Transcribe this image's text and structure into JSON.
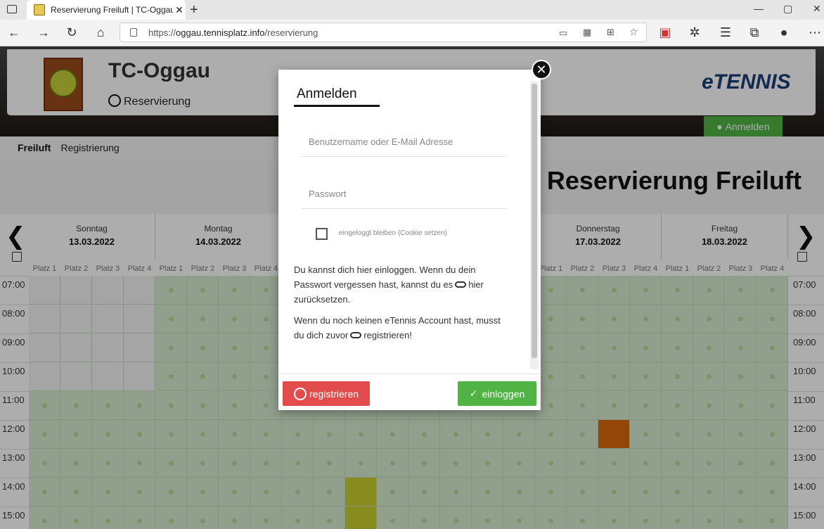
{
  "browser": {
    "tab_title": "Reservierung Freiluft | TC-Oggau",
    "url_prefix": "https://",
    "url_host": "oggau.tennisplatz.info",
    "url_path": "/reservierung"
  },
  "header": {
    "club_name": "TC-Oggau",
    "subtitle": "Reservierung",
    "brand": "eTENNIS",
    "login_button": "Anmelden"
  },
  "menu": {
    "items": [
      "Freiluft",
      "Registrierung"
    ]
  },
  "headline": "Reservierung Freiluft",
  "calendar": {
    "days": [
      {
        "weekday": "Sonntag",
        "date": "13.03.2022"
      },
      {
        "weekday": "Montag",
        "date": "14.03.2022"
      },
      {
        "weekday": "",
        "date": ""
      },
      {
        "weekday": "",
        "date": ""
      },
      {
        "weekday": "Donnerstag",
        "date": "17.03.2022"
      },
      {
        "weekday": "Freitag",
        "date": "18.03.2022"
      }
    ],
    "courts": [
      "Platz 1",
      "Platz 2",
      "Platz 3",
      "Platz 4"
    ],
    "times": [
      "07:00",
      "08:00",
      "09:00",
      "10:00",
      "11:00",
      "12:00",
      "13:00",
      "14:00",
      "15:00"
    ]
  },
  "modal": {
    "title": "Anmelden",
    "username_placeholder": "Benutzername oder E-Mail Adresse",
    "password_placeholder": "Passwort",
    "remember_label": "eingeloggt bleiben (Cookie setzen)",
    "text1_a": "Du kannst dich hier einloggen. Wenn du dein Passwort vergessen hast, kannst du es",
    "text1_link": "hier",
    "text1_b": "zurücksetzen.",
    "text2_a": "Wenn du noch keinen eTennis Account hast, musst du dich zuvor",
    "text2_link": "registrieren!",
    "register_button": "registrieren",
    "login_button": "einloggen"
  }
}
